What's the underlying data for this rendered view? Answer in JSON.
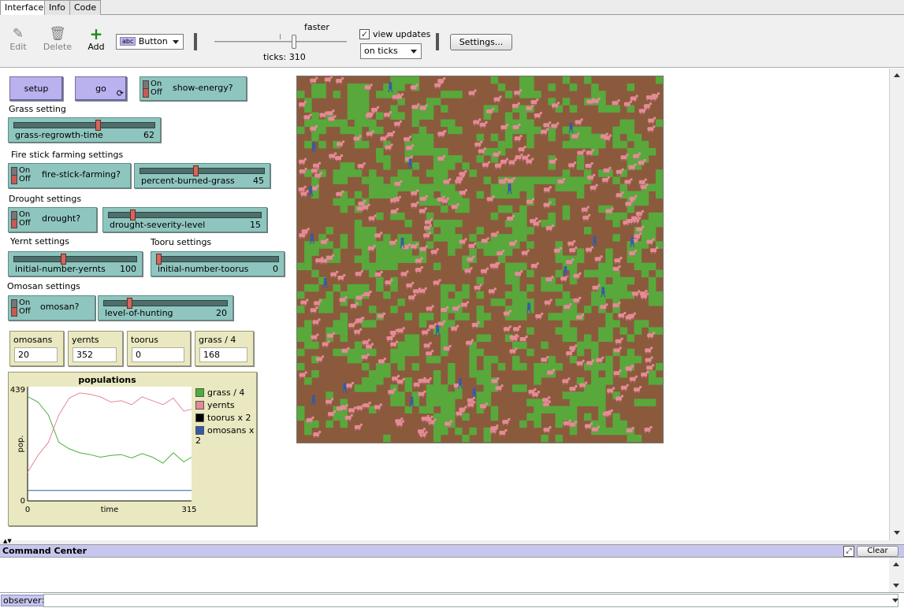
{
  "tabs": [
    {
      "label": "Interface",
      "active": true
    },
    {
      "label": "Info",
      "active": false
    },
    {
      "label": "Code",
      "active": false
    }
  ],
  "toolbar": {
    "edit_label": "Edit",
    "delete_label": "Delete",
    "add_label": "Add",
    "widget_type": "Button",
    "widget_type_prefix": "abc",
    "speed_label": "faster",
    "speed_fraction": 0.6,
    "ticks_label": "ticks: 310",
    "view_updates_label": "view updates",
    "view_updates_checked": true,
    "update_mode": "on ticks",
    "settings_label": "Settings..."
  },
  "widgets": {
    "setup_label": "setup",
    "go_label": "go",
    "show_energy": {
      "label": "show-energy?",
      "on": "On",
      "off": "Off",
      "state": "off"
    },
    "grass_note": "Grass setting",
    "grass_regrowth": {
      "name": "grass-regrowth-time",
      "value": "62",
      "fraction": 0.6
    },
    "fire_note": "Fire stick farming settings",
    "fire_switch": {
      "label": "fire-stick-farming?",
      "on": "On",
      "off": "Off",
      "state": "off"
    },
    "percent_burned": {
      "name": "percent-burned-grass",
      "value": "45",
      "fraction": 0.45
    },
    "drought_note": "Drought settings",
    "drought_switch": {
      "label": "drought?",
      "on": "On",
      "off": "Off",
      "state": "off"
    },
    "drought_severity": {
      "name": "drought-severity-level",
      "value": "15",
      "fraction": 0.15
    },
    "yernt_note": "Yernt settings",
    "tooru_note": "Tooru settings",
    "initial_yernts": {
      "name": "initial-number-yernts",
      "value": "100",
      "fraction": 0.4
    },
    "initial_toorus": {
      "name": "initial-number-toorus",
      "value": "0",
      "fraction": 0.0
    },
    "omosan_note": "Omosan settings",
    "omosan_switch": {
      "label": "omosan?",
      "on": "On",
      "off": "Off",
      "state": "off"
    },
    "level_hunting": {
      "name": "level-of-hunting",
      "value": "20",
      "fraction": 0.2
    }
  },
  "monitors": [
    {
      "name": "omosans",
      "value": "20"
    },
    {
      "name": "yernts",
      "value": "352"
    },
    {
      "name": "toorus",
      "value": "0"
    },
    {
      "name": "grass / 4",
      "value": "168"
    }
  ],
  "plot": {
    "title": "populations",
    "ylabel": "pop.",
    "xlabel": "time",
    "xmin_label": "0",
    "xmax_label": "315",
    "ymin_label": "0",
    "ymax_label": "439"
  },
  "chart_data": {
    "type": "line",
    "title": "populations",
    "xlabel": "time",
    "ylabel": "pop.",
    "xlim": [
      0,
      315
    ],
    "ylim": [
      0,
      439
    ],
    "legend_position": "right",
    "x": [
      0,
      20,
      40,
      60,
      80,
      100,
      120,
      140,
      160,
      180,
      200,
      220,
      240,
      260,
      280,
      300,
      315
    ],
    "series": [
      {
        "name": "grass / 4",
        "color": "#4caf3c",
        "values": [
          401,
          380,
          330,
          225,
          200,
          185,
          178,
          168,
          175,
          178,
          165,
          182,
          168,
          145,
          185,
          150,
          168
        ]
      },
      {
        "name": "yernts",
        "color": "#e58a96",
        "values": [
          110,
          175,
          225,
          330,
          395,
          415,
          410,
          400,
          380,
          385,
          370,
          400,
          385,
          370,
          395,
          345,
          352
        ]
      },
      {
        "name": "toorus x 2",
        "color": "#000000",
        "values": [
          0,
          0,
          0,
          0,
          0,
          0,
          0,
          0,
          0,
          0,
          0,
          0,
          0,
          0,
          0,
          0,
          0
        ]
      },
      {
        "name": "omosans x 2",
        "color": "#345aa8",
        "values": [
          40,
          40,
          40,
          40,
          40,
          40,
          40,
          40,
          40,
          40,
          40,
          40,
          40,
          40,
          40,
          40,
          40
        ]
      }
    ]
  },
  "colors": {
    "grass": "#58a83c",
    "dirt": "#8b5a3c",
    "yernt": "#e58a96",
    "omosan": "#345aa8"
  },
  "command_center": {
    "title": "Command Center",
    "clear_label": "Clear",
    "prompt": "observer>"
  }
}
